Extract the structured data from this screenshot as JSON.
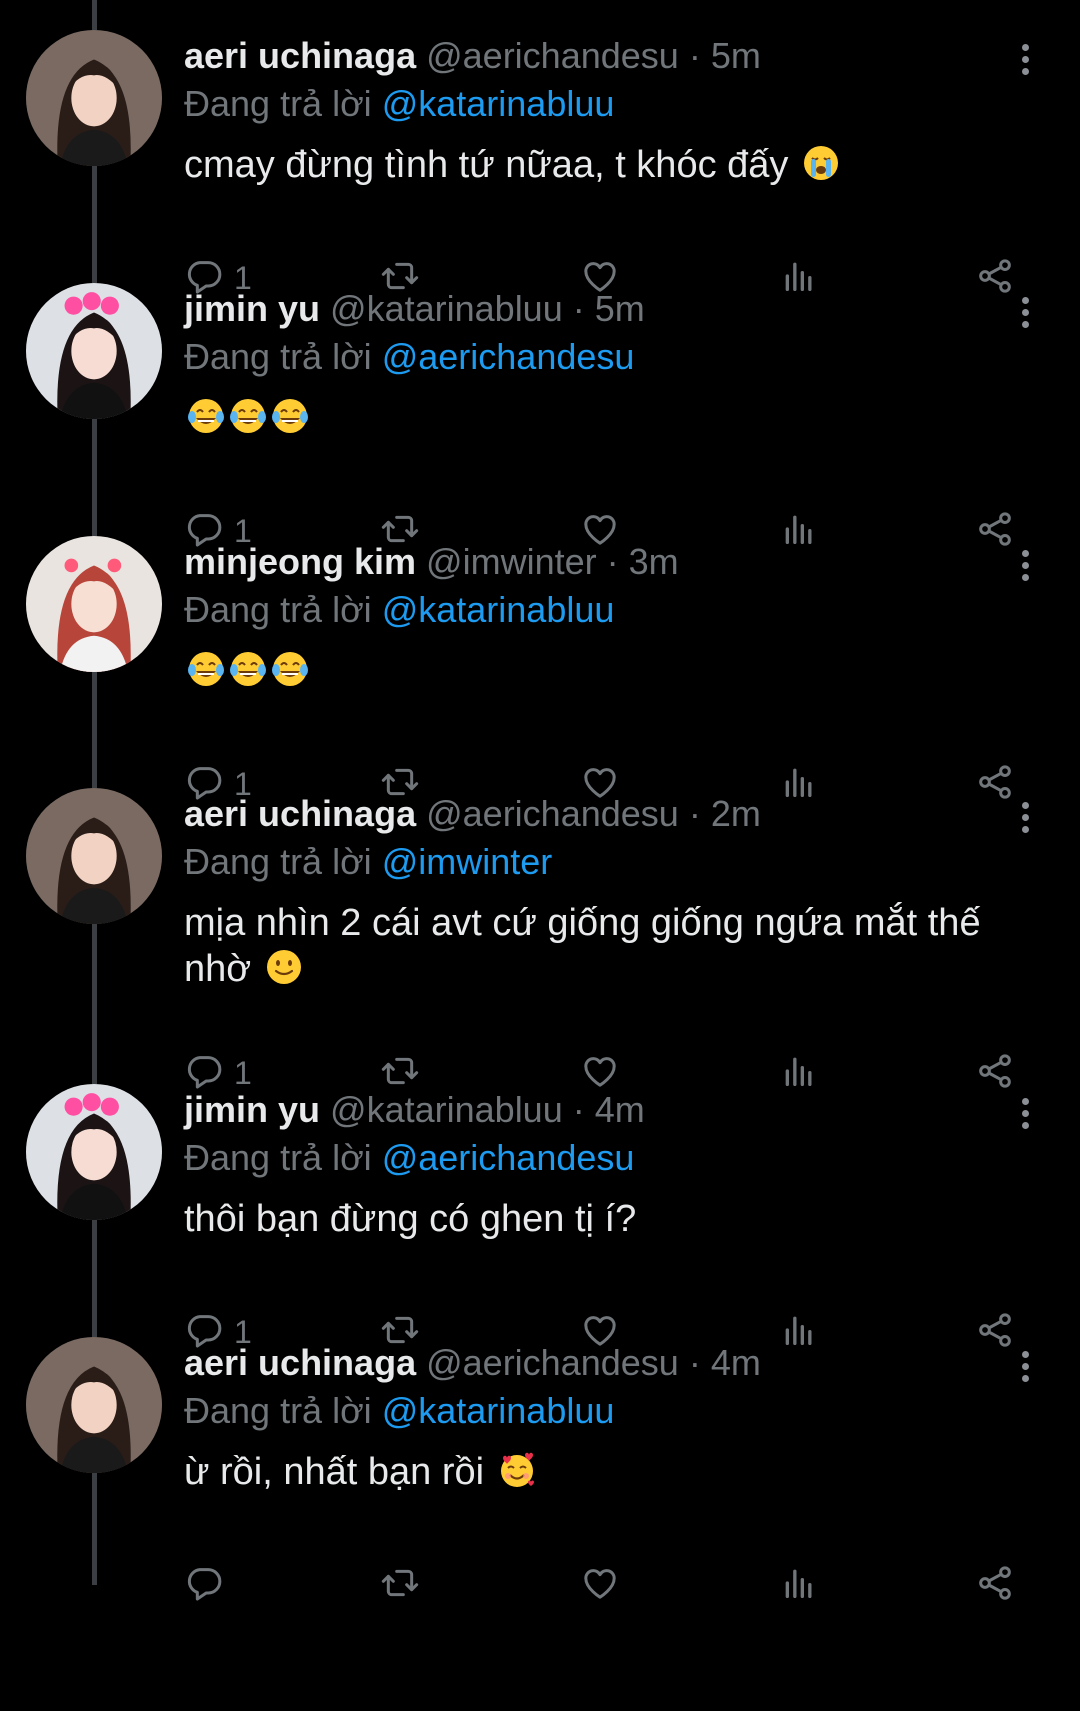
{
  "reply_prefix": "Đang trả lời",
  "separator": "·",
  "tweets": [
    {
      "name": "aeri uchinaga",
      "handle": "@aerichandesu",
      "time": "5m",
      "reply_to": "@katarinabluu",
      "text": "cmay đừng tình tứ nữaa, t khóc đấy",
      "emoji": [
        "loudly-crying-face"
      ],
      "replies": "1"
    },
    {
      "name": "jimin yu",
      "handle": "@katarinabluu",
      "time": "5m",
      "reply_to": "@aerichandesu",
      "text": "",
      "emoji": [
        "tears-of-joy-face",
        "tears-of-joy-face",
        "tears-of-joy-face"
      ],
      "replies": "1"
    },
    {
      "name": "minjeong kim",
      "handle": "@imwinter",
      "time": "3m",
      "reply_to": "@katarinabluu",
      "text": "",
      "emoji": [
        "tears-of-joy-face",
        "tears-of-joy-face",
        "tears-of-joy-face"
      ],
      "replies": "1"
    },
    {
      "name": "aeri uchinaga",
      "handle": "@aerichandesu",
      "time": "2m",
      "reply_to": "@imwinter",
      "text": "mịa nhìn 2 cái avt cứ giống giống ngứa mắt thế nhờ",
      "emoji": [
        "slightly-smiling-face"
      ],
      "replies": "1"
    },
    {
      "name": "jimin yu",
      "handle": "@katarinabluu",
      "time": "4m",
      "reply_to": "@aerichandesu",
      "text": "thôi bạn đừng có ghen tị í?",
      "emoji": [],
      "replies": "1"
    },
    {
      "name": "aeri uchinaga",
      "handle": "@aerichandesu",
      "time": "4m",
      "reply_to": "@katarinabluu",
      "text": "ừ rồi, nhất bạn rồi",
      "emoji": [
        "smiling-face-with-hearts"
      ],
      "replies": ""
    }
  ],
  "icons": [
    "more-vertical-icon",
    "reply-icon",
    "retweet-icon",
    "like-icon",
    "views-icon",
    "share-icon"
  ],
  "colors": {
    "background": "#000000",
    "text": "#e7e9ea",
    "muted": "#71767b",
    "link": "#1d9bf0",
    "thread_line": "#3b3f44"
  }
}
